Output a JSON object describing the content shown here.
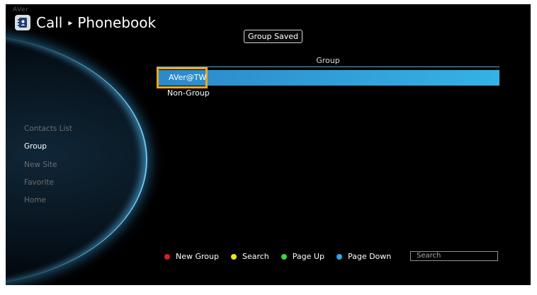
{
  "app": {
    "brand": "AVer"
  },
  "breadcrumb": {
    "section": "Call",
    "separator": "▸",
    "page": "Phonebook"
  },
  "toast": {
    "text": "Group Saved"
  },
  "group_list": {
    "header": "Group",
    "rows": [
      {
        "label": "AVer@TW",
        "selected": true
      },
      {
        "label": "Non-Group",
        "selected": false
      }
    ]
  },
  "sidebar": {
    "items": [
      {
        "label": "Contacts List",
        "active": false
      },
      {
        "label": "Group",
        "active": true
      },
      {
        "label": "New Site",
        "active": false
      },
      {
        "label": "Favorite",
        "active": false
      },
      {
        "label": "Home",
        "active": false
      }
    ]
  },
  "legend": {
    "items": [
      {
        "label": "New Group",
        "color": "#d6201f"
      },
      {
        "label": "Search",
        "color": "#f2e21a"
      },
      {
        "label": "Page Up",
        "color": "#3dd63d"
      },
      {
        "label": "Page Down",
        "color": "#29a8e8"
      }
    ]
  },
  "search": {
    "placeholder": "Search"
  },
  "icons": {
    "title_icon": "phonebook-icon"
  }
}
